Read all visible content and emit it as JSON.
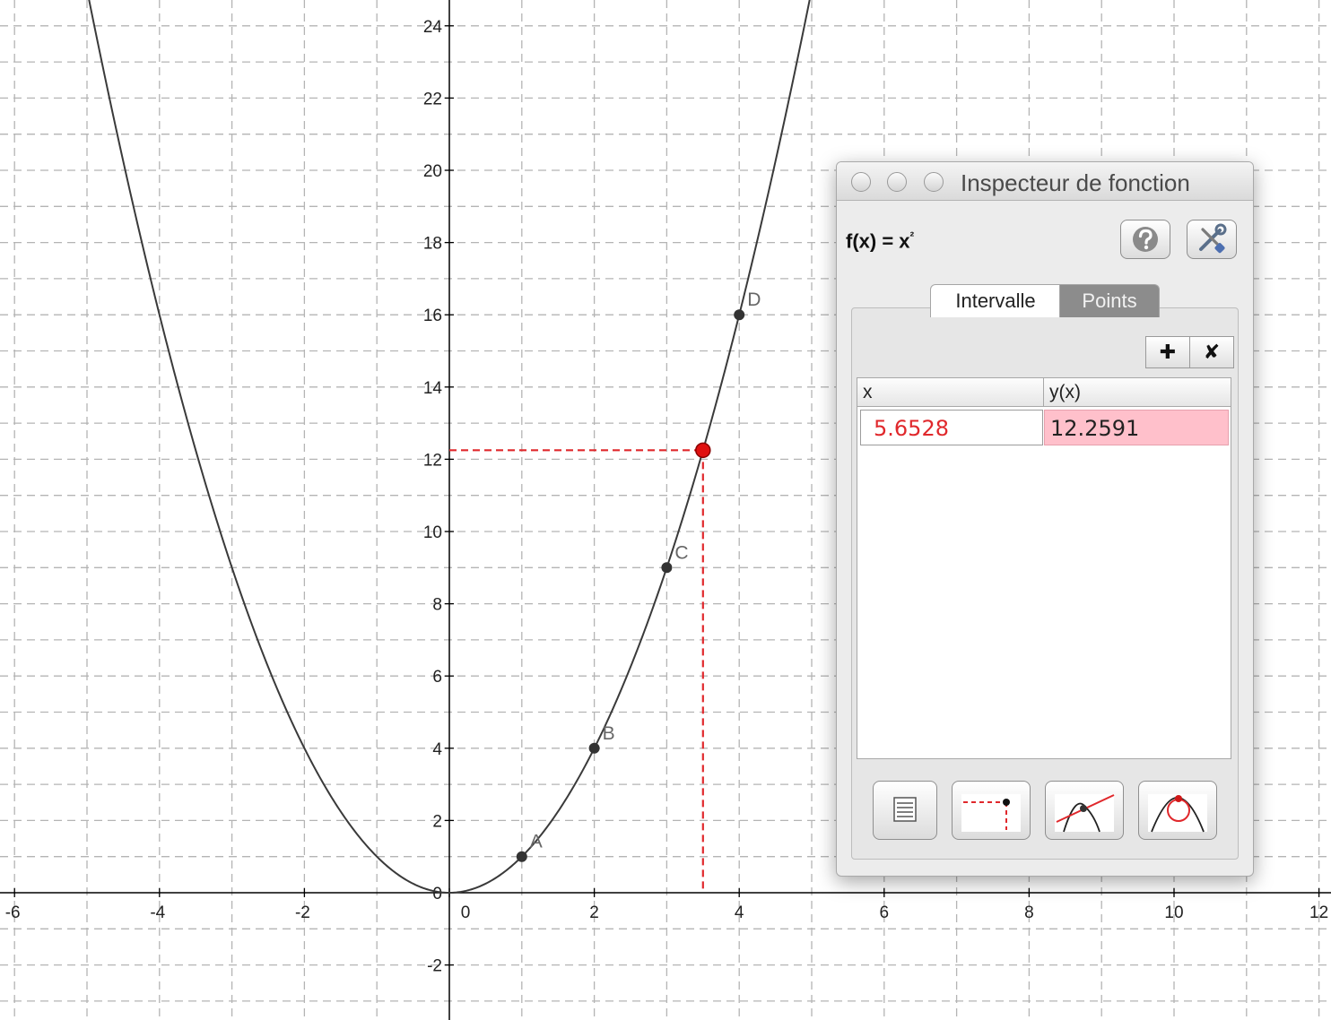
{
  "plot": {
    "x_tick_labels": [
      "-6",
      "-4",
      "-2",
      "0",
      "2",
      "4",
      "6",
      "8",
      "10",
      "12"
    ],
    "y_tick_labels": [
      "-2",
      "0",
      "2",
      "4",
      "6",
      "8",
      "10",
      "12",
      "14",
      "16",
      "18",
      "20",
      "22",
      "24"
    ],
    "origin_y_label": "0",
    "curve_color": "#3a3a3a",
    "trace_color": "#e0282c",
    "points": [
      {
        "label": "A",
        "x": 1,
        "y": 1
      },
      {
        "label": "B",
        "x": 2,
        "y": 4
      },
      {
        "label": "C",
        "x": 3,
        "y": 9
      },
      {
        "label": "D",
        "x": 4,
        "y": 16
      }
    ],
    "trace_point": {
      "x": 3.5,
      "y": 12.25
    }
  },
  "inspector": {
    "title": "Inspecteur de fonction",
    "function_label": "f(x) = x",
    "function_exponent": "²",
    "help_icon": "help-icon",
    "settings_icon": "wrench-screwdriver-icon",
    "tabs": [
      {
        "label": "Intervalle",
        "active": false
      },
      {
        "label": "Points",
        "active": true
      }
    ],
    "add_label": "✚",
    "remove_label": "✘",
    "columns": [
      "x",
      "y(x)"
    ],
    "rows": [
      {
        "x": "5.6528",
        "y": "12.2591"
      }
    ],
    "bottom_buttons": [
      "table-icon",
      "trace-point-icon",
      "tangent-icon",
      "osculating-circle-icon"
    ]
  }
}
